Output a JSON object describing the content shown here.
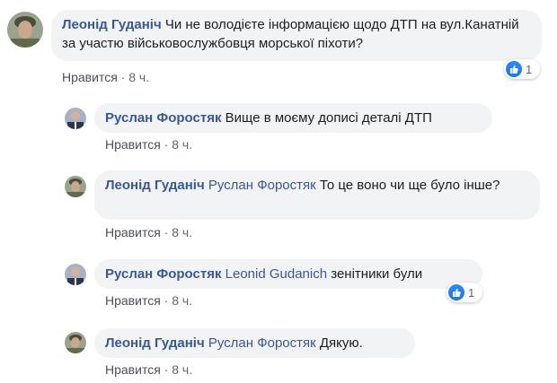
{
  "comments": [
    {
      "author": "Леонід Гуданіч",
      "text": "Чи не володієте інформацією щодо ДТП на вул.Канатній за участю військовослужбовця морської піхоти?",
      "like_label": "Нравится",
      "time": "8 ч.",
      "reactions": "1"
    },
    {
      "author": "Руслан Форостяк",
      "text": "Вище в моєму дописі деталі ДТП",
      "like_label": "Нравится",
      "time": "8 ч."
    },
    {
      "author": "Леонід Гуданіч",
      "mention": "Руслан Форостяк",
      "text": "То це воно чи ще було інше?",
      "like_label": "Нравится",
      "time": "8 ч."
    },
    {
      "author": "Руслан Форостяк",
      "mention": "Leonid Gudanich",
      "text": "зенітники були",
      "like_label": "Нравится",
      "time": "8 ч.",
      "reactions": "1"
    },
    {
      "author": "Леонід Гуданіч",
      "mention": "Руслан Форостяк",
      "text": "Дякую.",
      "like_label": "Нравится",
      "time": "8 ч."
    }
  ],
  "colors": {
    "link": "#385898",
    "bubble": "#f2f3f5",
    "meta": "#606770",
    "like_blue": "#1877f2"
  },
  "icons": [
    "avatar-soldier",
    "avatar-suit",
    "like-thumb-icon"
  ]
}
